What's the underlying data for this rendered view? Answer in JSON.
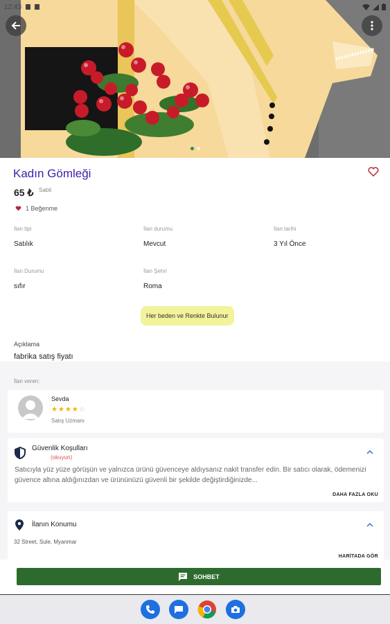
{
  "status_bar": {
    "time": "12:43"
  },
  "product": {
    "title": "Kadın Gömleği",
    "price": "65 ₺",
    "price_type": "Sabit",
    "likes": "1 Beğenme"
  },
  "details": [
    {
      "label": "İlan tipi",
      "value": "Satılık"
    },
    {
      "label": "İlan durumu",
      "value": "Mevcut"
    },
    {
      "label": "İlan tarihi",
      "value": "3 Yıl Önce"
    },
    {
      "label": "İlan Durumu",
      "value": "sıfır"
    },
    {
      "label": "İlan Şehri",
      "value": "Roma"
    }
  ],
  "tag": "Her beden ve Renkte Bulunur",
  "description": {
    "label": "Açıklama",
    "value": "fabrika satış fiyatı"
  },
  "seller": {
    "section_label": "İlan veren:",
    "name": "Sevda",
    "rating": 3.5,
    "role": "Satış Uzmanı"
  },
  "safety": {
    "title": "Güvenlik Koşulları",
    "subtitle": "(okuyun)",
    "body": "Satıcıyla yüz yüze görüşün ve yalnızca ürünü güvenceye aldıysanız nakit transfer edin. Bir satıcı olarak, ödemenizi güvence altına aldığınızdan ve ürününüzü güvenli bir şekilde değiştirdiğinizde...",
    "more_label": "DAHA FAZLA OKU"
  },
  "location": {
    "title": "İlanın Konumu",
    "address": "32 Street, Sule, Myanmar",
    "map_label": "HARİTADA GÖR"
  },
  "chat_button": "SOHBET",
  "colors": {
    "accent": "#3f20a8",
    "chat": "#2d6a2d",
    "tag_bg": "#f2f39a",
    "heart": "#b02a3a"
  }
}
